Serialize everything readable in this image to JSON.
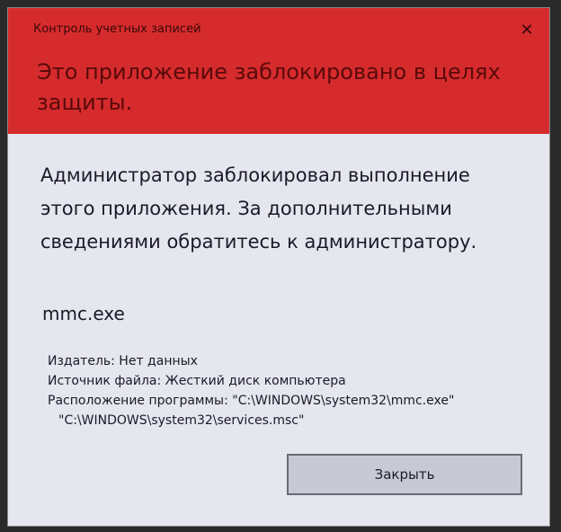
{
  "window": {
    "title": "Контроль учетных записей",
    "close_glyph": "✕"
  },
  "header": {
    "title": "Это приложение заблокировано в целях защиты."
  },
  "message": {
    "text": "Администратор заблокировал выполнение этого приложения. За дополнительными сведениями обратитесь к администратору."
  },
  "app": {
    "name": "mmc.exe"
  },
  "details": {
    "publisher": "Издатель: Нет данных",
    "source": "Источник файла: Жесткий диск компьютера",
    "location": "Расположение программы: \"C:\\WINDOWS\\system32\\mmc.exe\"",
    "location_arg": "\"C:\\WINDOWS\\system32\\services.msc\""
  },
  "buttons": {
    "close_label": "Закрыть"
  },
  "colors": {
    "header_red": "#d62b2d",
    "body_bg": "#e6e6ef",
    "button_bg": "#c9c9d4"
  }
}
